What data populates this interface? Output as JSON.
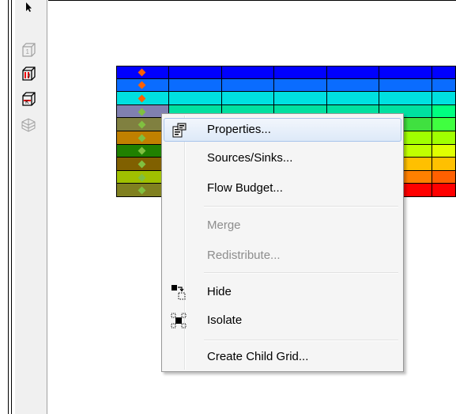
{
  "toolbar": {
    "tools": [
      {
        "name": "select-arrow-icon",
        "enabled": true
      },
      {
        "name": "layer-view-icon",
        "enabled": false
      },
      {
        "name": "column-view-icon",
        "enabled": true
      },
      {
        "name": "row-view-icon",
        "enabled": true
      },
      {
        "name": "3d-view-icon",
        "enabled": false
      }
    ]
  },
  "grid": {
    "row_colors": [
      [
        "#0000ff",
        "#0000ff",
        "#0000ff",
        "#0000ff",
        "#0000ff",
        "#0000ff",
        "#0000ff"
      ],
      [
        "#0a6cff",
        "#0a6cff",
        "#0a6cff",
        "#0a6cff",
        "#0a6cff",
        "#0a6cff",
        "#0a6cff"
      ],
      [
        "#00e0e0",
        "#00e0e0",
        "#00e0e0",
        "#00e0e0",
        "#00e0e0",
        "#00e0e0",
        "#00e0e0"
      ],
      [
        "#8080b0",
        "#00e0a0",
        "#00e0a0",
        "#00e0a0",
        "#00e0a0",
        "#00e0a0",
        "#00ff80"
      ],
      [
        "#808040",
        "#40e040",
        "#40e040",
        "#40e040",
        "#40e040",
        "#40e040",
        "#40ff40"
      ],
      [
        "#c08000",
        "#80e000",
        "#80e000",
        "#80e000",
        "#80e000",
        "#a0ff00",
        "#a0ff00"
      ],
      [
        "#208000",
        "#c0ff00",
        "#c0ff00",
        "#c0ff00",
        "#c0ff00",
        "#c0ff00",
        "#e0ff00"
      ],
      [
        "#806000",
        "#ffe000",
        "#ffe000",
        "#ffe000",
        "#ffe000",
        "#ffc000",
        "#ffc000"
      ],
      [
        "#a0c000",
        "#ff8000",
        "#ff8000",
        "#ff8000",
        "#ff8000",
        "#ff8000",
        "#ff6000"
      ],
      [
        "#808020",
        "#ff0000",
        "#ff0000",
        "#ff0000",
        "#ff0000",
        "#ff0000",
        "#ff0000"
      ]
    ],
    "marker_colors": [
      "#ff6000",
      "#ff6000",
      "#ff6000",
      "#80c040",
      "#80c040",
      "#80c040",
      "#80c040",
      "#80c040",
      "#80c040",
      "#80c040"
    ]
  },
  "context_menu": {
    "items": [
      {
        "label": "Properties...",
        "enabled": true,
        "icon": "properties-icon"
      },
      {
        "label": "Sources/Sinks...",
        "enabled": true
      },
      {
        "label": "Flow Budget...",
        "enabled": true
      },
      {
        "label": "Merge",
        "enabled": false
      },
      {
        "label": "Redistribute...",
        "enabled": false
      },
      {
        "label": "Hide",
        "enabled": true,
        "icon": "hide-icon"
      },
      {
        "label": "Isolate",
        "enabled": true,
        "icon": "isolate-icon"
      },
      {
        "label": "Create Child Grid...",
        "enabled": true
      }
    ]
  }
}
